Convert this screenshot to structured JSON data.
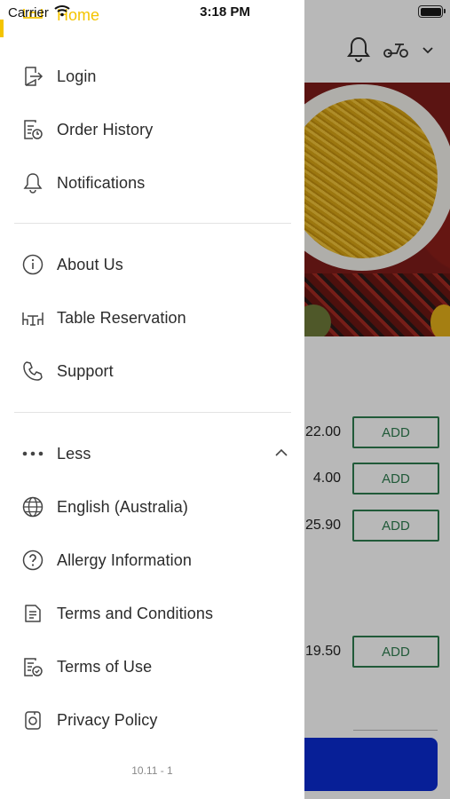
{
  "status_bar": {
    "carrier": "Carrier",
    "time": "3:18 PM"
  },
  "background": {
    "prices": [
      "22.00",
      "4.00",
      "25.90",
      "19.50"
    ],
    "add_label": "ADD"
  },
  "drawer": {
    "home_label": "Home",
    "items": [
      {
        "label": "Login",
        "icon": "login-icon"
      },
      {
        "label": "Order History",
        "icon": "order-history-icon"
      },
      {
        "label": "Notifications",
        "icon": "bell-icon"
      },
      {
        "label": "About Us",
        "icon": "info-icon"
      },
      {
        "label": "Table Reservation",
        "icon": "table-icon"
      },
      {
        "label": "Support",
        "icon": "phone-icon"
      },
      {
        "label": "Less",
        "icon": "more-dots-icon"
      },
      {
        "label": "English (Australia)",
        "icon": "globe-icon"
      },
      {
        "label": "Allergy Information",
        "icon": "question-icon"
      },
      {
        "label": "Terms and Conditions",
        "icon": "document-icon"
      },
      {
        "label": "Terms of Use",
        "icon": "document-check-icon"
      },
      {
        "label": "Privacy Policy",
        "icon": "privacy-icon"
      }
    ],
    "version": "10.11 - 1"
  },
  "colors": {
    "accent": "#f4c400",
    "add_button": "#2e7d4f",
    "bottom_bar": "#0b2cd1"
  }
}
